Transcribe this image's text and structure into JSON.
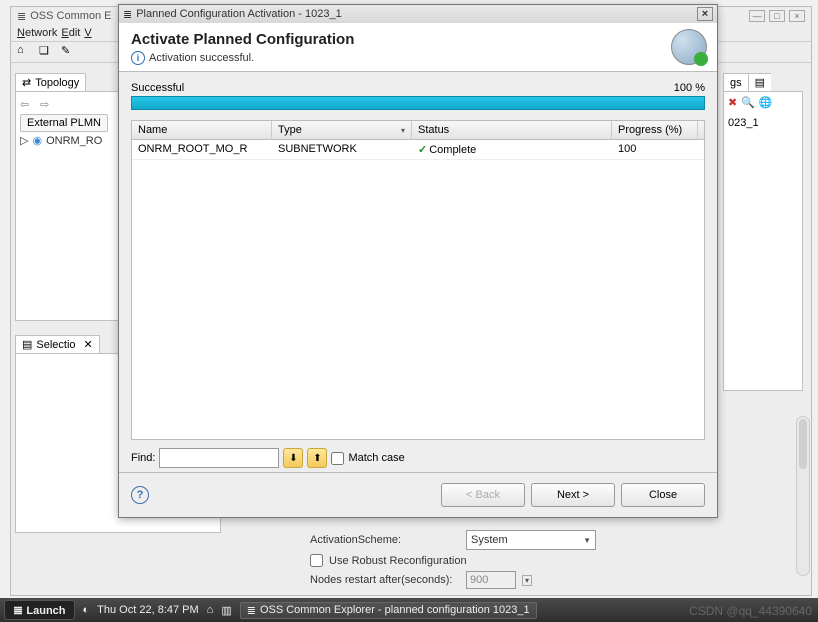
{
  "bg": {
    "title": "OSS Common E",
    "menu": [
      "Network",
      "Edit",
      "V"
    ],
    "left_panel": "Topology",
    "ext_btn": "External PLMN",
    "tree_root": "ONRM_RO",
    "selection": "Selectio",
    "right_tab": "gs",
    "right_sub": "023_1"
  },
  "form": {
    "scheme_label": "ActivationScheme:",
    "scheme_value": "System",
    "robust": "Use Robust Reconfiguration",
    "restart_label": "Nodes restart after(seconds):",
    "restart_value": "900"
  },
  "dialog": {
    "title": "Planned Configuration Activation - 1023_1",
    "heading": "Activate Planned Configuration",
    "sub": "Activation successful.",
    "progress_label": "Successful",
    "progress_pct": "100 %",
    "cols": {
      "name": "Name",
      "type": "Type",
      "status": "Status",
      "prog": "Progress (%)"
    },
    "row": {
      "name": "ONRM_ROOT_MO_R",
      "type": "SUBNETWORK",
      "status": "Complete",
      "prog": "100"
    },
    "find_label": "Find:",
    "match": "Match case",
    "back": "< Back",
    "next": "Next >",
    "close": "Close"
  },
  "taskbar": {
    "launch": "Launch",
    "clock": "Thu Oct 22,  8:47 PM",
    "task": "OSS Common Explorer - planned configuration 1023_1"
  },
  "watermark": "CSDN @qq_44390640"
}
